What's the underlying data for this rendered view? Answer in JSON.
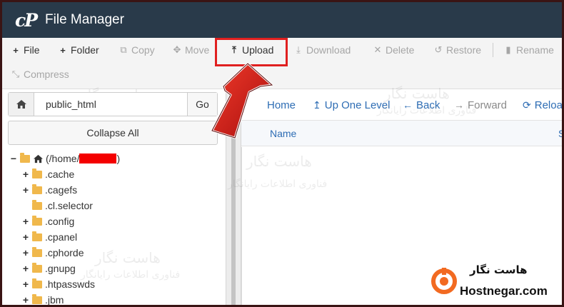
{
  "header": {
    "logo": "cP",
    "title": "File Manager"
  },
  "toolbar": {
    "file": "File",
    "folder": "Folder",
    "copy": "Copy",
    "move": "Move",
    "upload": "Upload",
    "download": "Download",
    "delete": "Delete",
    "restore": "Restore",
    "rename": "Rename",
    "compress": "Compress"
  },
  "left": {
    "path_value": "public_html",
    "go": "Go",
    "collapse": "Collapse All",
    "root_prefix": "(/home/",
    "root_suffix": ")",
    "items": [
      ".cache",
      ".cagefs",
      ".cl.selector",
      ".config",
      ".cpanel",
      ".cphorde",
      ".gnupg",
      ".htpasswds",
      ".jbm"
    ]
  },
  "right": {
    "home": "Home",
    "up": "Up One Level",
    "back": "Back",
    "forward": "Forward",
    "reload": "Reload",
    "col_name": "Name",
    "col_size": "S"
  },
  "watermark": {
    "line1": "هاست نگار",
    "line2": "فناوری اطلاعات رایانگار"
  },
  "brand": {
    "fa": "هاست نگار",
    "en": "Hostnegar.com"
  },
  "colors": {
    "header": "#293a4a",
    "link": "#2e6db4",
    "highlight": "#e02020",
    "arrow": "#d11a1a",
    "folder": "#f0b84c"
  }
}
